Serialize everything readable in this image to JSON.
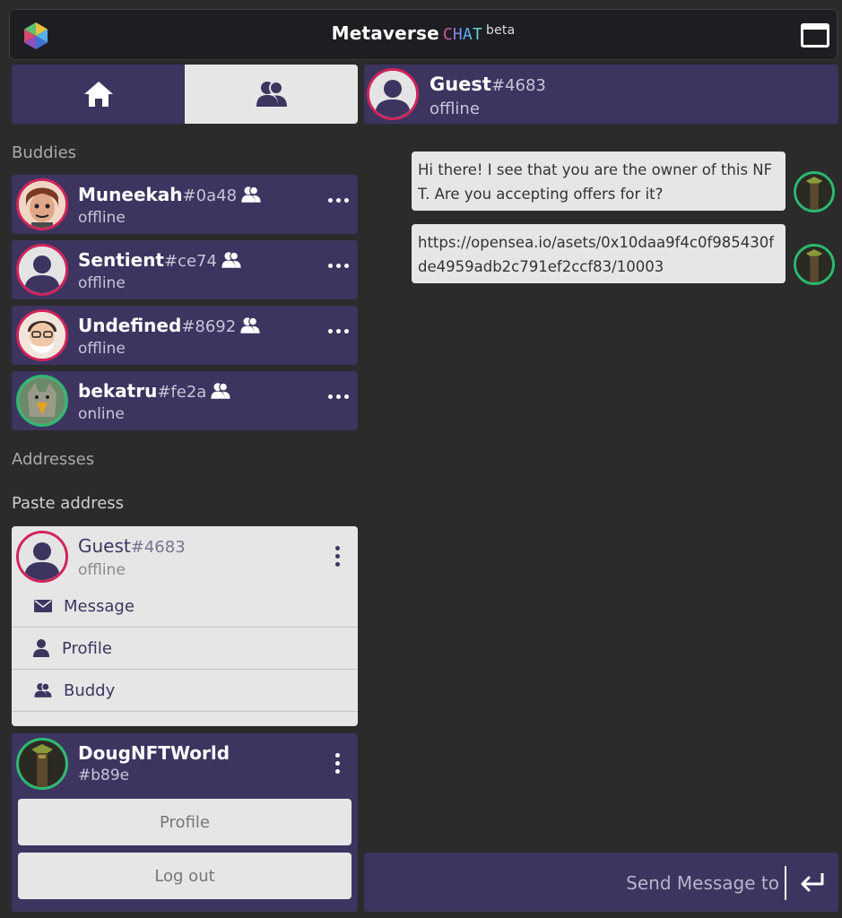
{
  "header": {
    "title_part1": "Metaverse",
    "title_part2": "CHAT",
    "title_badge": "beta",
    "logo_icon": "cube-logo-icon",
    "window_icon": "window-maximize-icon"
  },
  "tabs": [
    {
      "icon": "home-icon",
      "active": false
    },
    {
      "icon": "buddies-icon",
      "active": true
    }
  ],
  "sections": {
    "buddies": "Buddies",
    "addresses": "Addresses",
    "paste_address": "Paste address"
  },
  "buddies": [
    {
      "name": "Muneekah",
      "tag": "#0a48",
      "status": "offline",
      "online": false
    },
    {
      "name": "Sentient",
      "tag": "#ce74",
      "status": "offline",
      "online": false
    },
    {
      "name": "Undefined",
      "tag": "#8692",
      "status": "offline",
      "online": false
    },
    {
      "name": "bekatru",
      "tag": "#fe2a",
      "status": "online",
      "online": true
    }
  ],
  "guest_card": {
    "name": "Guest",
    "tag": "#4683",
    "status": "offline",
    "actions": [
      {
        "icon": "envelope-icon",
        "label": "Message"
      },
      {
        "icon": "person-icon",
        "label": "Profile"
      },
      {
        "icon": "buddies-icon",
        "label": "Buddy"
      }
    ]
  },
  "me_card": {
    "name": "DougNFTWorld",
    "tag": "#b89e",
    "profile_label": "Profile",
    "logout_label": "Log out"
  },
  "chat": {
    "contact_name": "Guest",
    "contact_tag": "#4683",
    "contact_status": "offline",
    "messages": [
      {
        "text": "Hi there! I see that you are the owner of this NFT. Are you accepting offers for it?"
      },
      {
        "text": "https://opensea.io/asets/0x10daa9f4c0f985430fde4959adb2c791ef2ccf83/10003"
      }
    ],
    "composer_placeholder": "Send Message to",
    "send_icon": "enter-return-icon"
  },
  "colors": {
    "background": "#2b2b2b",
    "panel_purple": "#3e3460",
    "light_panel": "#e6e6e6",
    "offline_ring": "#d0245a",
    "online_ring": "#2bb970"
  }
}
